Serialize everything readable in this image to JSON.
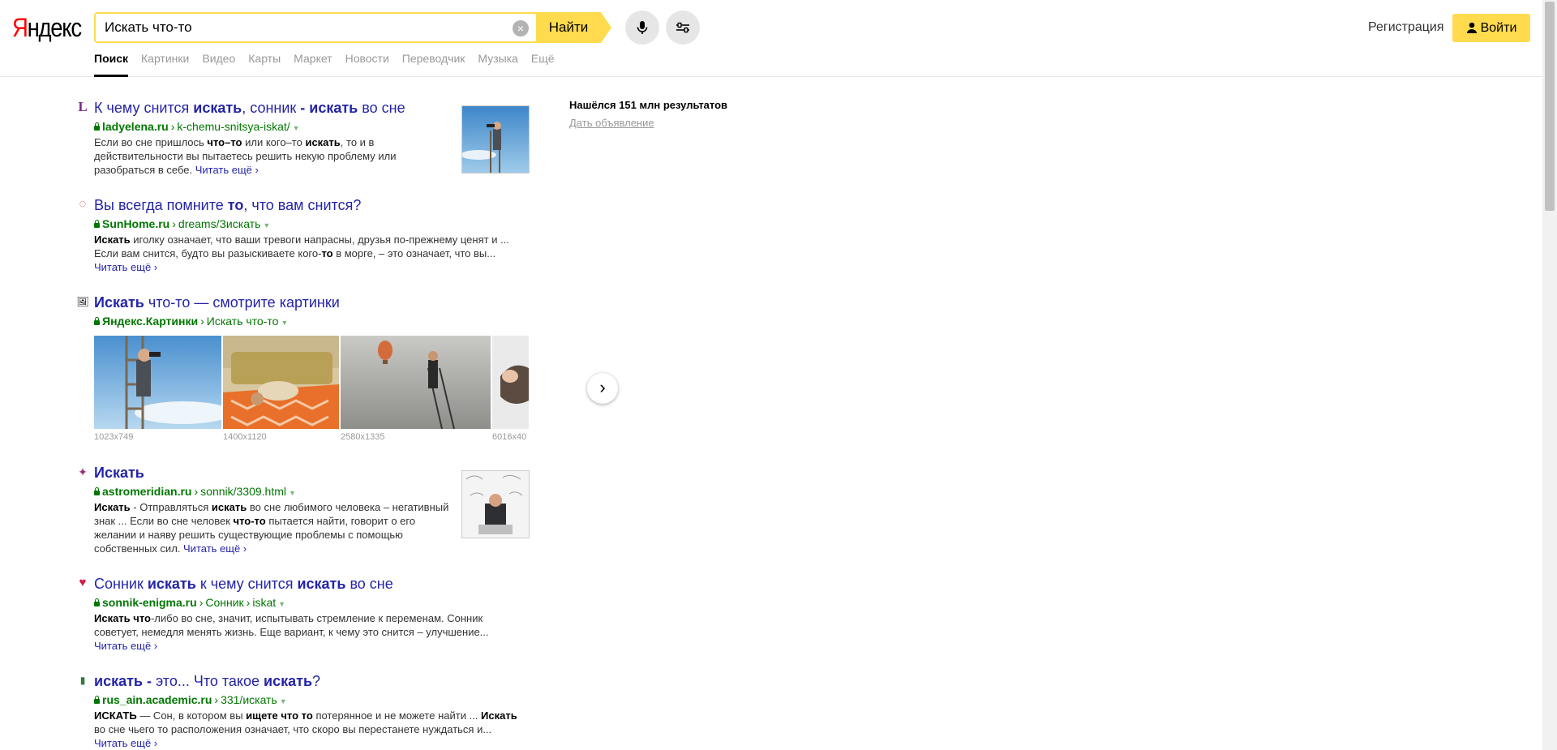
{
  "header": {
    "logo_first": "Я",
    "logo_rest": "ндекс",
    "search_value": "Искать что-то",
    "clear_glyph": "×",
    "find_label": "Найти",
    "register_label": "Регистрация",
    "login_label": "Войти",
    "accent_color": "#ffdb4d"
  },
  "nav": {
    "items": [
      "Поиск",
      "Картинки",
      "Видео",
      "Карты",
      "Маркет",
      "Новости",
      "Переводчик",
      "Музыка",
      "Ещё"
    ],
    "active": "Поиск"
  },
  "sidebar": {
    "found_text": "Нашёлся 151 млн результатов",
    "ad_link": "Дать объявление"
  },
  "results": [
    {
      "favicon": "L",
      "title_parts": [
        "К чему снится ",
        "искать",
        ", сонник ",
        "- искать",
        " во сне"
      ],
      "host": "ladyelena.ru",
      "path": "k-chemu-snitsya-iskat/",
      "text_parts": [
        "Если во сне пришлось ",
        "что–то",
        " или кого–то ",
        "искать",
        ", то и в действительности вы пытаетесь решить некую проблему или разобраться в себе. "
      ],
      "more": "Читать ещё ›"
    },
    {
      "favicon": "◌",
      "title_parts": [
        "Вы всегда помните ",
        "то",
        ", что вам снится?"
      ],
      "host": "SunHome.ru",
      "path": "dreams/Зискать",
      "text_parts": [
        "Искать",
        " иголку означает, что ваши тревоги напрасны, друзья по-прежнему ценят и ... Если вам снится, будто вы разыскиваете кого-",
        "то",
        " в морге, – это означает, что вы..."
      ],
      "more": "Читать ещё ›"
    },
    {
      "favicon": "🖼",
      "title_parts": [
        "Искать",
        " что-то — смотрите картинки"
      ],
      "host": "Яндекс.Картинки",
      "path": "Искать что-то",
      "image_sizes": [
        "1023x749",
        "1400x1120",
        "2580x1335",
        "6016x40"
      ]
    },
    {
      "favicon": "✦",
      "title_parts": [
        "Искать"
      ],
      "host": "astromeridian.ru",
      "path": "sonnik/3309.html",
      "text_parts": [
        "Искать",
        " - Отправляться ",
        "искать",
        " во сне любимого человека – негативный знак ... Если во сне человек ",
        "что-то",
        " пытается найти, говорит о его желании и наяву решить существующие проблемы с помощью собственных сил. "
      ],
      "more": "Читать ещё ›"
    },
    {
      "favicon": "♥",
      "title_parts": [
        "Сонник ",
        "искать",
        " к чему снится ",
        "искать",
        " во сне"
      ],
      "host": "sonnik-enigma.ru",
      "path": "Сонник",
      "path2": "iskat",
      "text_parts": [
        "Искать что",
        "-либо во сне, значит, испытывать стремление к переменам. Сонник советует, немедля менять жизнь. Еще вариант, к чему это снится – улучшение..."
      ],
      "more": "Читать ещё ›"
    },
    {
      "favicon": "▮",
      "title_parts": [
        "искать - ",
        "это... Что такое ",
        "искать",
        "?"
      ],
      "host": "rus_ain.academic.ru",
      "path": "331/искать",
      "text_parts": [
        "ИСКАТЬ",
        " — Сон, в котором вы ",
        "ищете что то",
        " потерянное и не можете найти ... ",
        "Искать",
        " во сне чьего то расположения означает, что скоро вы перестанете нуждаться и..."
      ],
      "more": "Читать ещё ›"
    }
  ],
  "colors": {
    "link": "#2424a8",
    "url": "#007700",
    "text": "#333333"
  }
}
